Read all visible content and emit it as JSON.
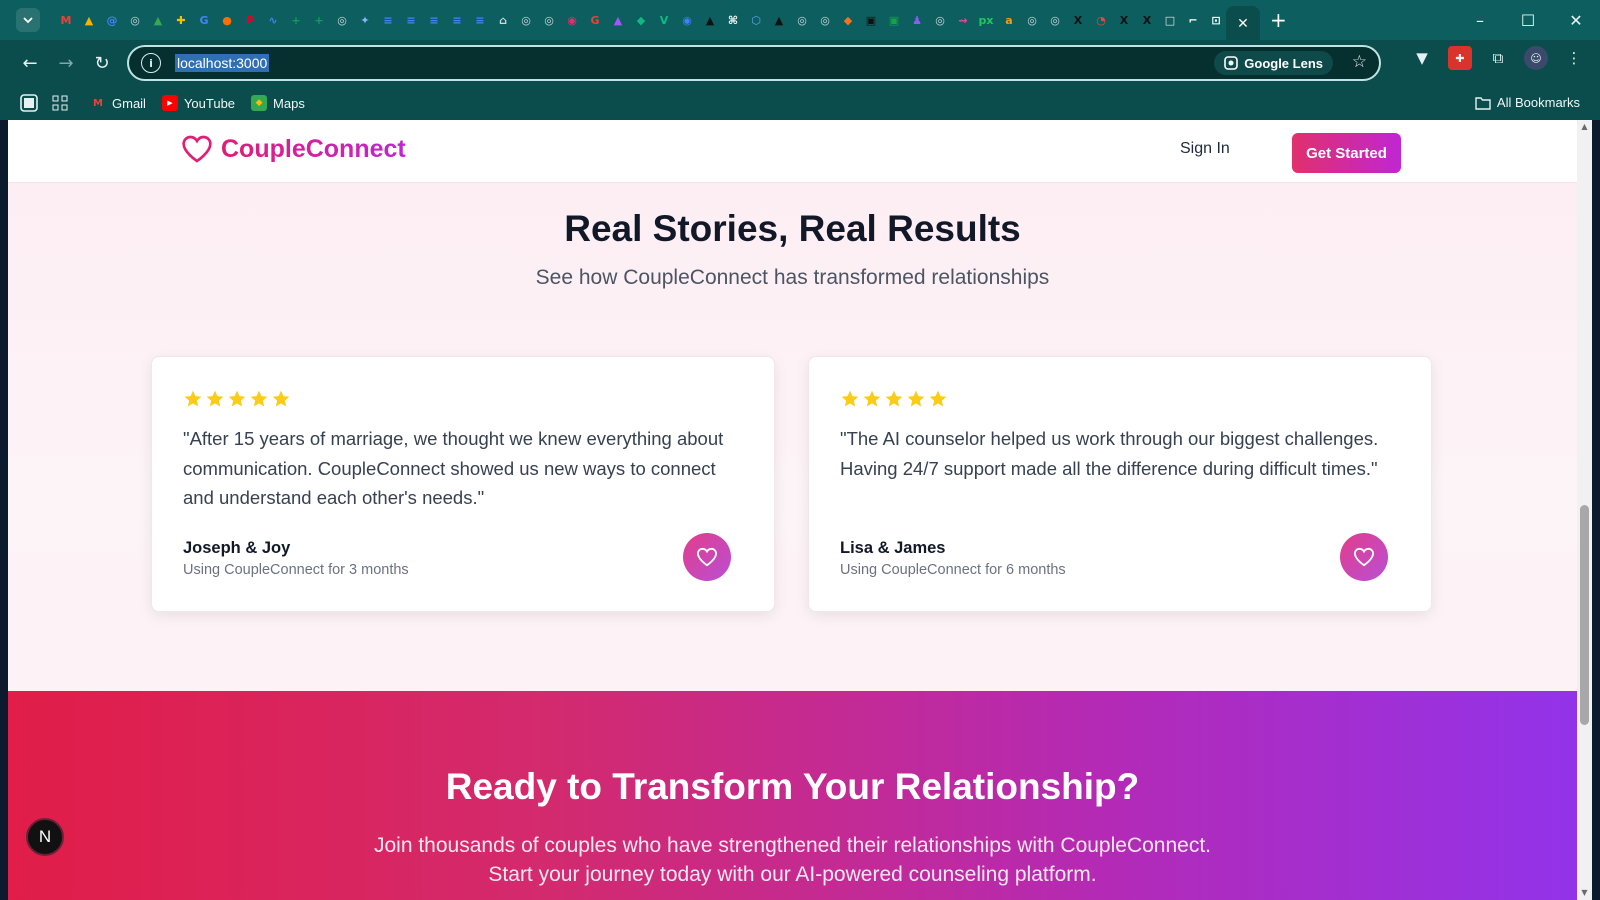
{
  "browser": {
    "url": "localhost:3000",
    "lens_label": "Google Lens",
    "active_tab_close": "✕",
    "new_tab": "+",
    "favicons": [
      "M",
      "▲",
      "@",
      "◎",
      "▲",
      "✚",
      "G",
      "●",
      "P",
      "∿",
      "+",
      "+",
      "◎",
      "✦",
      "≡",
      "≡",
      "≡",
      "≡",
      "≡",
      "⌂",
      "◎",
      "◎",
      "◉",
      "G",
      "▲",
      "◆",
      "V",
      "◉",
      "▲",
      "⌘",
      "⬡",
      "▲",
      "◎",
      "◎",
      "◆",
      "▣",
      "▣",
      "♟",
      "◎",
      "⇝",
      "px",
      "a",
      "◎",
      "◎",
      "X",
      "◔",
      "X",
      "X",
      "□",
      "⌐",
      "⊡"
    ],
    "favicon_colors": [
      "#ea4335",
      "#f4b400",
      "#4285f4",
      "#cfd8dc",
      "#34a853",
      "#fbbc04",
      "#4285f4",
      "#ff6d00",
      "#e60023",
      "#3b82f6",
      "#0f9d58",
      "#0f9d58",
      "#cfd8dc",
      "#8ab4f8",
      "#4285f4",
      "#4285f4",
      "#4285f4",
      "#4285f4",
      "#4285f4",
      "#cfd8dc",
      "#cfd8dc",
      "#cfd8dc",
      "#e1306c",
      "#ea4335",
      "#a855f7",
      "#10b981",
      "#10b981",
      "#3b82f6",
      "#111111",
      "#ffffff",
      "#60a5fa",
      "#111111",
      "#cfd8dc",
      "#cfd8dc",
      "#f97316",
      "#111111",
      "#16a34a",
      "#8b5cf6",
      "#cfd8dc",
      "#ec4899",
      "#22c55e",
      "#f59e0b",
      "#cfd8dc",
      "#cfd8dc",
      "#111111",
      "#ef4444",
      "#111111",
      "#111111",
      "#e5e7eb",
      "#ffffff",
      "#ffffff"
    ]
  },
  "bookmarks": {
    "items": [
      {
        "label": "Gmail",
        "icon": "gmail-icon"
      },
      {
        "label": "YouTube",
        "icon": "youtube-icon"
      },
      {
        "label": "Maps",
        "icon": "maps-icon"
      }
    ],
    "all_label": "All Bookmarks"
  },
  "site": {
    "brand": "CoupleConnect",
    "sign_in": "Sign In",
    "get_started": "Get Started",
    "accent_pink": "#e1306c",
    "accent_purple": "#c026d3"
  },
  "testimonials": {
    "title": "Real Stories, Real Results",
    "subtitle": "See how CoupleConnect has transformed relationships",
    "cards": [
      {
        "rating": 5,
        "quote": "\"After 15 years of marriage, we thought we knew everything about communication. CoupleConnect showed us new ways to connect and understand each other's needs.\"",
        "author": "Joseph & Joy",
        "since": "Using CoupleConnect for 3 months"
      },
      {
        "rating": 5,
        "quote": "\"The AI counselor helped us work through our biggest challenges. Having 24/7 support made all the difference during difficult times.\"",
        "author": "Lisa & James",
        "since": "Using CoupleConnect for 6 months"
      }
    ]
  },
  "cta": {
    "title": "Ready to Transform Your Relationship?",
    "text_line1": "Join thousands of couples who have strengthened their relationships with CoupleConnect.",
    "text_line2": "Start your journey today with our AI-powered counseling platform."
  },
  "next_badge": "N"
}
